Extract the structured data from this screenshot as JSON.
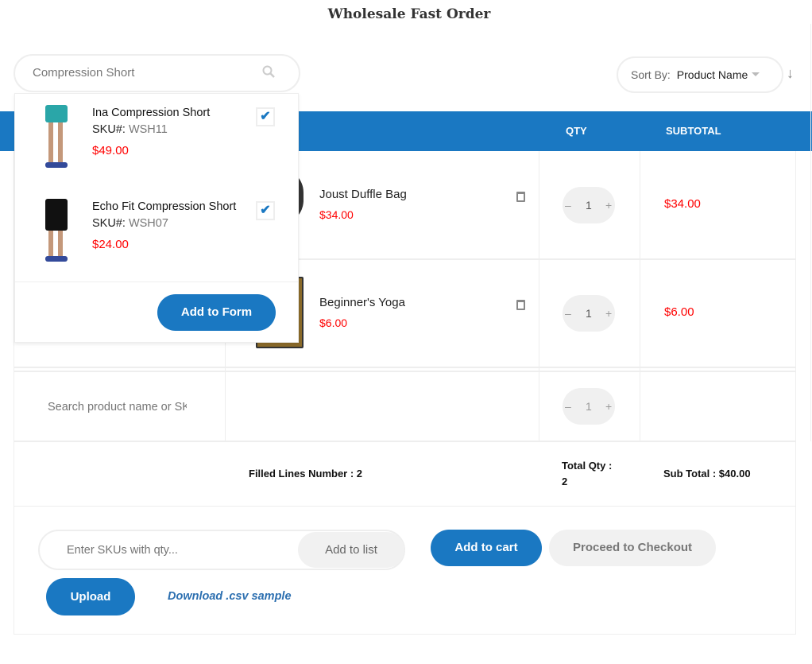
{
  "page": {
    "title": "Wholesale Fast Order"
  },
  "search": {
    "value": "Compression Short",
    "icon": "search-icon"
  },
  "sort": {
    "label": "Sort By:",
    "value": "Product Name",
    "direction_icon": "arrow-down-icon"
  },
  "table": {
    "headers": {
      "qty": "QTY",
      "subtotal": "SUBTOTAL"
    },
    "rows": [
      {
        "name": "Joust Duffle Bag",
        "price": "$34.00",
        "qty": "1",
        "subtotal": "$34.00"
      },
      {
        "name": "Beginner's Yoga",
        "price": "$6.00",
        "qty": "1",
        "subtotal": "$6.00"
      }
    ],
    "empty_row": {
      "placeholder": "Search product name or SKU",
      "qty": "1"
    },
    "stepper": {
      "minus": "–",
      "plus": "+"
    }
  },
  "dropdown": {
    "items": [
      {
        "name": "Ina Compression Short",
        "sku_label": "SKU#:",
        "sku": "WSH11",
        "price": "$49.00",
        "checked": true,
        "color": "#2aa6a8"
      },
      {
        "name": "Echo Fit Compression Short",
        "sku_label": "SKU#:",
        "sku": "WSH07",
        "price": "$24.00",
        "checked": true,
        "color": "#111111"
      }
    ],
    "add_button": "Add to Form",
    "check": "✔"
  },
  "totals": {
    "filled_lines": "Filled Lines Number : 2",
    "total_qty_label": "Total Qty :",
    "total_qty": "2",
    "sub_total": "Sub Total : $40.00"
  },
  "actions": {
    "sku_placeholder": "Enter SKUs with qty...",
    "add_to_list": "Add to list",
    "add_to_cart": "Add to cart",
    "checkout": "Proceed to Checkout",
    "upload": "Upload",
    "download": "Download .csv sample"
  },
  "colors": {
    "accent": "#1a78c2",
    "price": "#ff0000"
  }
}
